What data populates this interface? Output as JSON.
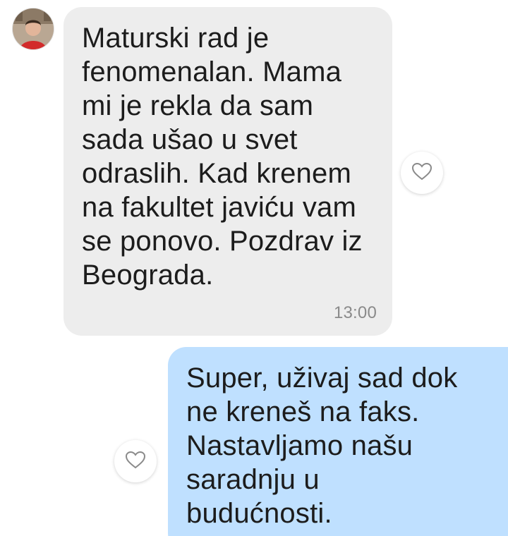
{
  "messages": [
    {
      "direction": "incoming",
      "text": "Maturski rad je\nfenomenalan. Mama\nmi je rekla da sam\nsada ušao u svet\nodraslih. Kad krenem\nna fakultet javiću vam\nse ponovo. Pozdrav iz\nBeograda.",
      "time": "13:00",
      "reaction_icon": "heart-outline-icon"
    },
    {
      "direction": "outgoing",
      "text": "Super, uživaj sad dok\nne kreneš na faks.\nNastavljamo našu\nsaradnju u\nbudućnosti.",
      "reaction_icon": "heart-outline-icon"
    }
  ],
  "colors": {
    "incoming_bubble": "#ededed",
    "outgoing_bubble": "#bfe0ff",
    "text": "#1c1c1c",
    "timestamp": "#8a8a8a"
  }
}
